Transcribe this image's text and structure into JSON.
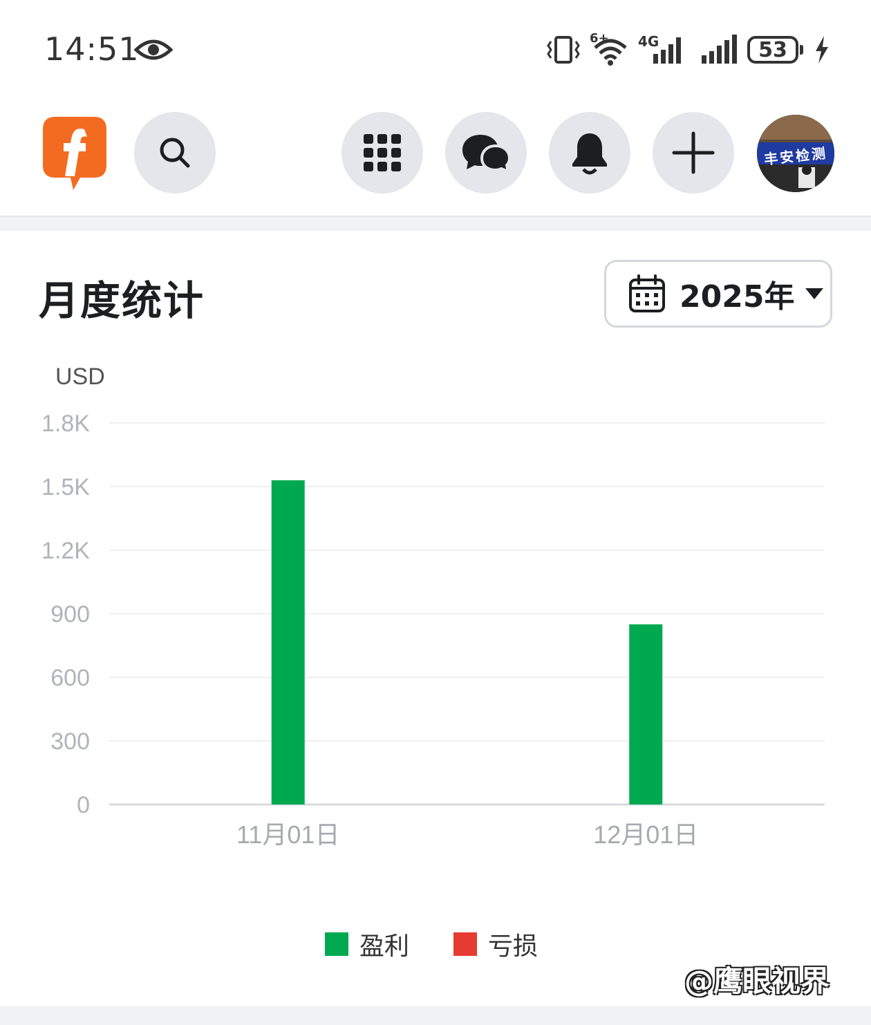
{
  "status_bar": {
    "time": "14:51",
    "network_label": "4G",
    "wifi_label": "6+",
    "battery": "53"
  },
  "header": {
    "logo_icon": "brand-f-logo",
    "buttons": [
      "search-icon",
      "apps-grid-icon",
      "messenger-icon",
      "bell-icon",
      "plus-icon"
    ],
    "avatar_text": "丰安检测"
  },
  "card": {
    "title": "月度统计",
    "year": "2025年"
  },
  "chart_data": {
    "type": "bar",
    "ylabel": "USD",
    "categories": [
      "11月01日",
      "12月01日"
    ],
    "y_ticks": [
      "0",
      "300",
      "600",
      "900",
      "1.2K",
      "1.5K",
      "1.8K"
    ],
    "ylim": [
      0,
      1800
    ],
    "grid": true,
    "legend_placement": "bottom",
    "series": [
      {
        "name": "盈利",
        "color": "#00a94f",
        "values": [
          1530,
          850
        ]
      },
      {
        "name": "亏损",
        "color": "#e53b30",
        "values": [
          0,
          0
        ]
      }
    ]
  },
  "watermark": "@鹰眼视界"
}
